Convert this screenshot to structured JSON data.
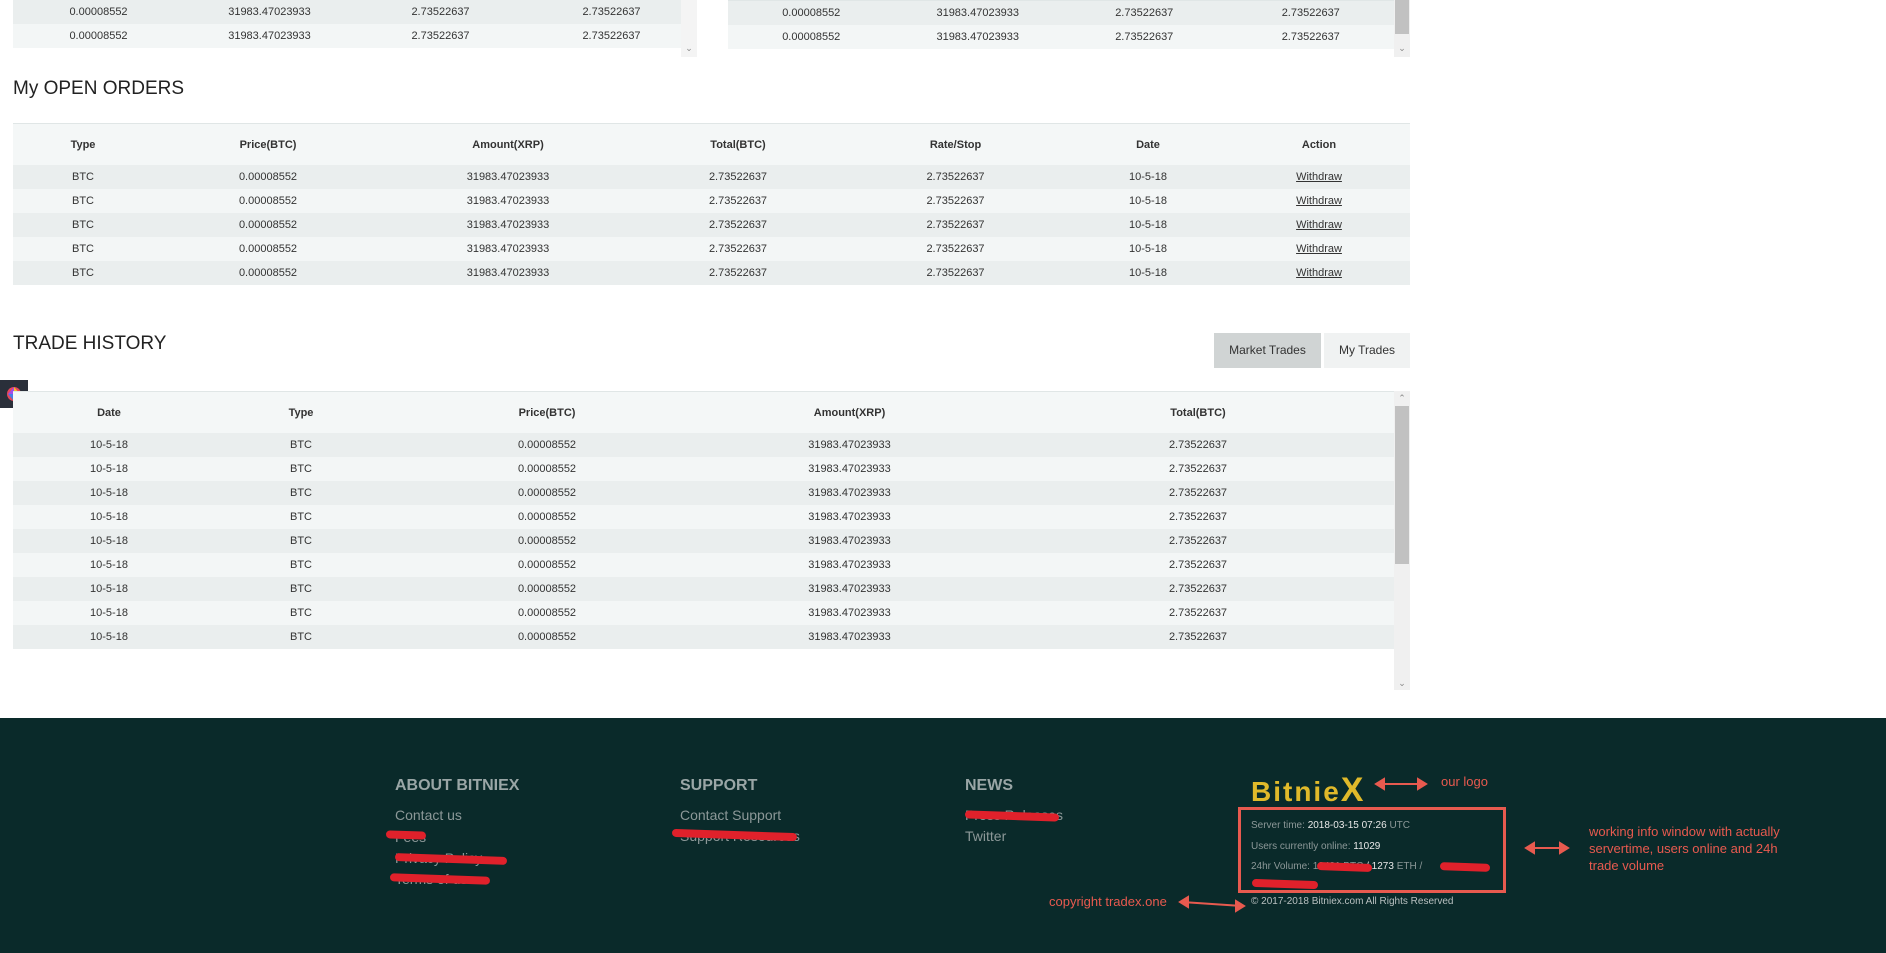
{
  "top_tables": {
    "left_rows": [
      [
        "0.00008552",
        "31983.47023933",
        "2.73522637",
        "2.73522637"
      ],
      [
        "0.00008552",
        "31983.47023933",
        "2.73522637",
        "2.73522637"
      ]
    ],
    "right_rows": [
      [
        "0.00008552",
        "31983.47023933",
        "2.73522637",
        "2.73522637"
      ],
      [
        "0.00008552",
        "31983.47023933",
        "2.73522637",
        "2.73522637"
      ]
    ]
  },
  "open_orders": {
    "title": "My OPEN ORDERS",
    "headers": [
      "Type",
      "Price(BTC)",
      "Amount(XRP)",
      "Total(BTC)",
      "Rate/Stop",
      "Date",
      "Action"
    ],
    "rows": [
      [
        "BTC",
        "0.00008552",
        "31983.47023933",
        "2.73522637",
        "2.73522637",
        "10-5-18",
        "Withdraw"
      ],
      [
        "BTC",
        "0.00008552",
        "31983.47023933",
        "2.73522637",
        "2.73522637",
        "10-5-18",
        "Withdraw"
      ],
      [
        "BTC",
        "0.00008552",
        "31983.47023933",
        "2.73522637",
        "2.73522637",
        "10-5-18",
        "Withdraw"
      ],
      [
        "BTC",
        "0.00008552",
        "31983.47023933",
        "2.73522637",
        "2.73522637",
        "10-5-18",
        "Withdraw"
      ],
      [
        "BTC",
        "0.00008552",
        "31983.47023933",
        "2.73522637",
        "2.73522637",
        "10-5-18",
        "Withdraw"
      ]
    ]
  },
  "trade_history": {
    "title": "TRADE HISTORY",
    "tabs": [
      "Market Trades",
      "My Trades"
    ],
    "active_tab": "Market Trades",
    "headers": [
      "Date",
      "Type",
      "Price(BTC)",
      "Amount(XRP)",
      "Total(BTC)"
    ],
    "rows": [
      [
        "10-5-18",
        "BTC",
        "0.00008552",
        "31983.47023933",
        "2.73522637"
      ],
      [
        "10-5-18",
        "BTC",
        "0.00008552",
        "31983.47023933",
        "2.73522637"
      ],
      [
        "10-5-18",
        "BTC",
        "0.00008552",
        "31983.47023933",
        "2.73522637"
      ],
      [
        "10-5-18",
        "BTC",
        "0.00008552",
        "31983.47023933",
        "2.73522637"
      ],
      [
        "10-5-18",
        "BTC",
        "0.00008552",
        "31983.47023933",
        "2.73522637"
      ],
      [
        "10-5-18",
        "BTC",
        "0.00008552",
        "31983.47023933",
        "2.73522637"
      ],
      [
        "10-5-18",
        "BTC",
        "0.00008552",
        "31983.47023933",
        "2.73522637"
      ],
      [
        "10-5-18",
        "BTC",
        "0.00008552",
        "31983.47023933",
        "2.73522637"
      ],
      [
        "10-5-18",
        "BTC",
        "0.00008552",
        "31983.47023933",
        "2.73522637"
      ]
    ]
  },
  "footer": {
    "about_title": "ABOUT BITNIEX",
    "about_links": [
      "Contact us",
      "Fees",
      "Privacy Policy",
      "Terms of use"
    ],
    "support_title": "SUPPORT",
    "support_links": [
      "Contact Support",
      "Support Resources"
    ],
    "news_title": "NEWS",
    "news_links": [
      "Press Releases",
      "Twitter"
    ],
    "logo_text": "Bitnie",
    "logo_x": "X",
    "server_time_label": "Server time:",
    "server_time_value": "2018-03-15 07:26",
    "server_time_tz": "UTC",
    "users_online_label": "Users currently online:",
    "users_online_value": "11029",
    "volume_label": "24hr Volume:",
    "volume_btc": "12481 BTC",
    "volume_sep": "/",
    "volume_eth": "1273",
    "volume_eth_unit": "ETH /",
    "copyright": "© 2017-2018 Bitniex.com All Rights Reserved"
  },
  "annotations": {
    "logo_note": "our logo",
    "info_note": "working info window with actually servertime, users online and 24h trade volume",
    "copyright_note": "copyright tradex.one"
  },
  "colors": {
    "footer_bg": "#0a2a2a",
    "logo_gold": "#e0b92a",
    "annotation_red": "#e85a4f",
    "scribble_red": "#e0212b",
    "active_tab_bg": "#d0d4d4"
  }
}
